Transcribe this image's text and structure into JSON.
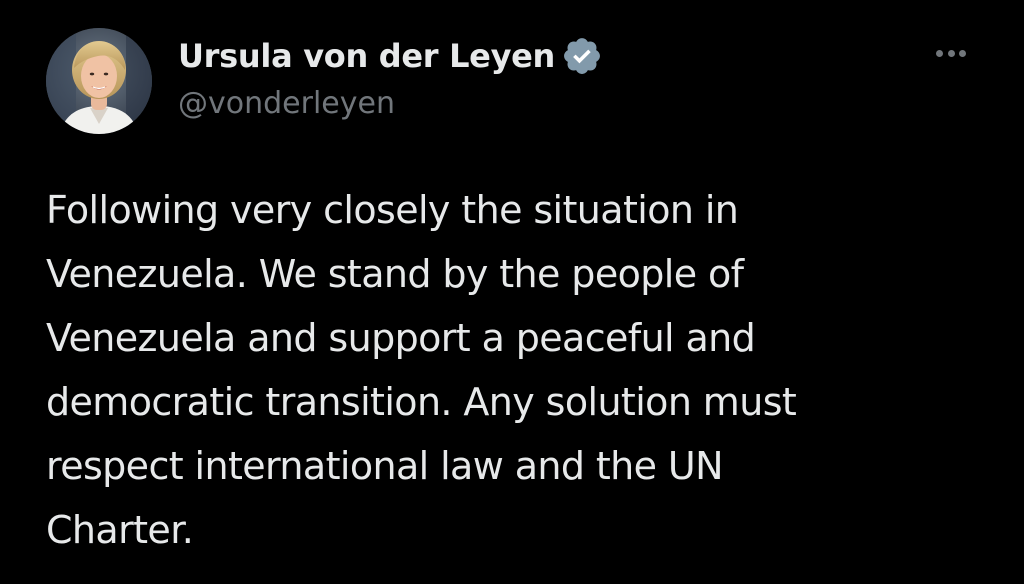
{
  "author": {
    "display_name": "Ursula von der Leyen",
    "handle": "@vonderleyen",
    "avatar_icon": "profile-photo",
    "verified_icon": "verified-badge-icon"
  },
  "post": {
    "text_lines": [
      "Following very closely the situation in",
      "Venezuela. We stand by the people of",
      "Venezuela and support a peaceful and",
      "democratic transition. Any solution must",
      "respect international law and the UN",
      "Charter."
    ]
  },
  "actions": {
    "more_icon": "more-options-icon"
  },
  "colors": {
    "background": "#000000",
    "primary_text": "#e7e9ea",
    "secondary_text": "#71767b",
    "verified_badge": "#829aab"
  }
}
